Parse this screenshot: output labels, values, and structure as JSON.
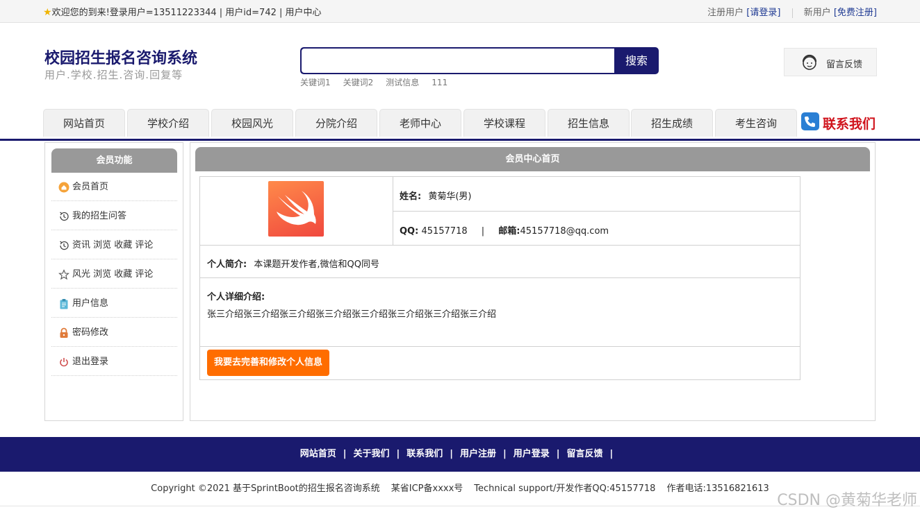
{
  "topbar": {
    "welcome": "欢迎您的到来!",
    "login_info": "登录用户=13511223344 | 用户id=742 | 用户中心",
    "registered_prefix": "注册用户",
    "login_link": "[请登录]",
    "new_prefix": "新用户",
    "register_link": "[免费注册]"
  },
  "header": {
    "title": "校园招生报名咨询系统",
    "subtitle": "用户.学校.招生.咨询.回复等",
    "search_button": "搜索",
    "search_value": "",
    "keywords": [
      "关键词1",
      "关键词2",
      "测试信息",
      "111"
    ],
    "feedback_label": "留言反馈"
  },
  "nav": {
    "items": [
      "网站首页",
      "学校介绍",
      "校园风光",
      "分院介绍",
      "老师中心",
      "学校课程",
      "招生信息",
      "招生成绩",
      "考生咨询"
    ],
    "contact_label": "联系我们"
  },
  "sidebar": {
    "title": "会员功能",
    "items": [
      {
        "label": "会员首页",
        "icon": "home-icon"
      },
      {
        "label": "我的招生问答",
        "icon": "history-icon"
      },
      {
        "label": "资讯 浏览 收藏 评论",
        "icon": "history-icon"
      },
      {
        "label": "风光 浏览 收藏 评论",
        "icon": "star-icon"
      },
      {
        "label": "用户信息",
        "icon": "clipboard-icon"
      },
      {
        "label": "密码修改",
        "icon": "lock-icon"
      },
      {
        "label": "退出登录",
        "icon": "power-icon"
      }
    ]
  },
  "main": {
    "title": "会员中心首页",
    "name_label": "姓名:",
    "name_value": "黄菊华(男)",
    "qq_label": "QQ:",
    "qq_value": "45157718",
    "divider": "|",
    "email_label": "邮箱:",
    "email_value": "45157718@qq.com",
    "intro_label": "个人简介:",
    "intro_value": "本课题开发作者,微信和QQ同号",
    "detail_label": "个人详细介绍:",
    "detail_value": "张三介绍张三介绍张三介绍张三介绍张三介绍张三介绍张三介绍张三介绍",
    "edit_button": "我要去完善和修改个人信息"
  },
  "footer": {
    "links": [
      "网站首页",
      "关于我们",
      "联系我们",
      "用户注册",
      "用户登录",
      "留言反馈"
    ],
    "pipe": "|",
    "copyright": "Copyright ©2021 基于SprintBoot的招生报名咨询系统",
    "icp": "某省ICP备xxxx号",
    "support": "Technical support/开发作者QQ:45157718",
    "phone": "作者电话:13516821613"
  },
  "watermark": "CSDN @黄菊华老师",
  "colors": {
    "brand_navy": "#1a1a6e",
    "panel_gray": "#999999",
    "button_orange": "#ff6d00",
    "contact_red": "#d0121b"
  }
}
